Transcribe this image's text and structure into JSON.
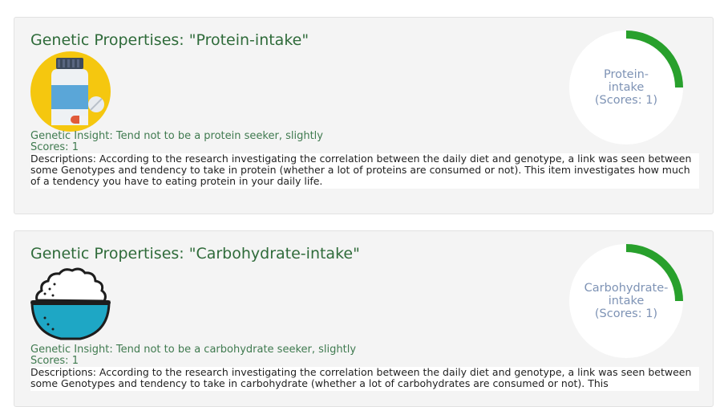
{
  "cards": [
    {
      "title": "Genetic Propertises: \"Protein-intake\"",
      "icon": "protein-supplement-bottle-icon",
      "insight": "Genetic Insight: Tend not to be a protein seeker, slightly",
      "scores": "Scores: 1",
      "description": "Descriptions: According to the research investigating the correlation between the daily diet and genotype, a link was seen between some Genotypes and tendency to take in protein (whether a lot of proteins are consumed or not). This item investigates how much of a tendency you have to eating protein in your daily life.",
      "gauge": {
        "line1": "Protein-",
        "line2": "intake",
        "line3": "(Scores: 1)",
        "score": 1,
        "fraction": 0.25,
        "color": "#28a02c"
      }
    },
    {
      "title": "Genetic Propertises: \"Carbohydrate-intake\"",
      "icon": "rice-bowl-icon",
      "insight": "Genetic Insight: Tend not to be a carbohydrate seeker, slightly",
      "scores": "Scores: 1",
      "description": "Descriptions: According to the research investigating the correlation between the daily diet and genotype, a link was seen between some Genotypes and tendency to take in carbohydrate (whether a lot of carbohydrates are consumed or not). This",
      "gauge": {
        "line1": "Carbohydrate-",
        "line2": "intake",
        "line3": "(Scores: 1)",
        "score": 1,
        "fraction": 0.25,
        "color": "#28a02c"
      }
    }
  ],
  "colors": {
    "title": "#2f6b3a",
    "insight": "#3f7a4f",
    "gauge_text": "#7e93b5",
    "gauge_track": "#ffffff",
    "icon_circle": "#f5c70f",
    "rice_bowl": "#1ea7c5"
  }
}
